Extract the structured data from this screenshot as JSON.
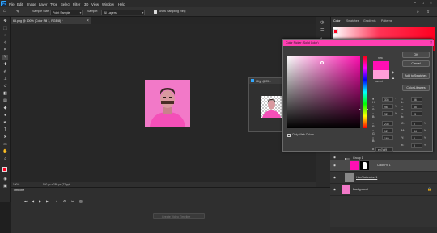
{
  "menubar": {
    "items": [
      "File",
      "Edit",
      "Image",
      "Layer",
      "Type",
      "Select",
      "Filter",
      "3D",
      "View",
      "Window",
      "Help"
    ]
  },
  "options": {
    "sample_size_label": "Sample Size:",
    "sample_size_value": "Point Sample",
    "sample_label": "Sample:",
    "sample_value": "All Layers",
    "show_ring_label": "Show Sampling Ring"
  },
  "document": {
    "tab_title": "65.png @ 100% (Color Fill 1, RGB/8) *",
    "zoom": "100%",
    "doc_info": "540 px x 289 px (72 ppi)"
  },
  "timeline": {
    "tab_label": "Timeline",
    "create_button": "Create Video Timeline"
  },
  "float_window": {
    "title": "68.jp @ 23..."
  },
  "panels": {
    "tabs": [
      "Color",
      "Swatches",
      "Gradients",
      "Patterns"
    ]
  },
  "color_picker": {
    "title": "Color Picker (Solid Color)",
    "new_label": "new",
    "current_label": "current",
    "buttons": {
      "ok": "OK",
      "cancel": "Cancel",
      "add_to_swatches": "Add to Swatches",
      "color_libraries": "Color Libraries"
    },
    "fields": {
      "H": "336",
      "S": "96",
      "B": "92",
      "R": "235",
      "G": "12",
      "Bl": "169",
      "L": "56",
      "a": "85",
      "b2": "-3",
      "C": "0",
      "M": "84",
      "Y": "0",
      "K": "0"
    },
    "only_web_colors": "Only Web Colors",
    "hex": "eb7cd9",
    "accent_color": "#ff3fb2"
  },
  "layers": {
    "items": [
      {
        "name": "Group 1"
      },
      {
        "name": "Color Fill 1"
      },
      {
        "name": "Hue/Saturation 1"
      },
      {
        "name": "Background"
      }
    ]
  }
}
